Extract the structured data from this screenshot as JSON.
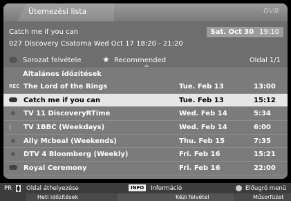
{
  "window": {
    "title": "Ütemezési lista",
    "logo": "DVB"
  },
  "program": {
    "name": "Catch me if you can",
    "channel": "027 Discovery Csatorna Wed Oct 17   18:20 - 21:20",
    "current_date": "Sat. Oct 30",
    "current_time": "19:10",
    "series_label": "Sorozat felvétele",
    "recommended_label": "Recommended",
    "page": "Oldal 1/1"
  },
  "list": {
    "header": "Általános időzítések",
    "rows": [
      {
        "icon": "REC",
        "title": "The Lord of the Rings",
        "date": "Tue. Feb 13",
        "time": "13:00"
      },
      {
        "icon": "pill",
        "title": "Catch me if you can",
        "date": "Tue. Feb 13",
        "time": "15:12"
      },
      {
        "icon": "dot",
        "title": "TV  11 DiscoveryRTime",
        "date": "Wed. Feb 14",
        "time": "5:34"
      },
      {
        "icon": "bar",
        "title": "TV  1BBC (Weekdays)",
        "date": "Wed. Feb 14",
        "time": "6:00"
      },
      {
        "icon": "dot",
        "title": "Ally Mcbeal (Weekends)",
        "date": "Thu. Feb 15",
        "time": "7:35"
      },
      {
        "icon": "dot",
        "title": "DTV 4 Bloomberg (Weekly)",
        "date": "Fri. Feb 16",
        "time": "15:21"
      },
      {
        "icon": "pill",
        "title": "Royal Ceremony",
        "date": "Fri. Feb 16",
        "time": "22:00"
      }
    ],
    "selected_index": 1
  },
  "footer": {
    "pr": "PR",
    "page_move": "Oldal áthelyezése",
    "info_key": "INFO",
    "info_label": "Információ",
    "back_label": "Előugró menü",
    "weekly": "Heti időzítések",
    "manual": "Kézi felvétel",
    "guide": "Műsorfüzet"
  }
}
